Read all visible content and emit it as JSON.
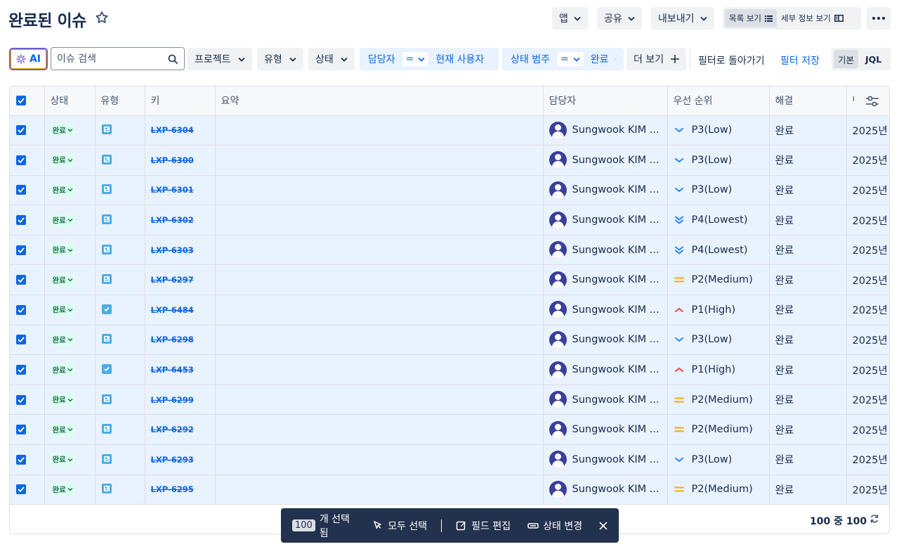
{
  "header": {
    "title": "완료된 이슈",
    "apps_label": "앱",
    "share_label": "공유",
    "export_label": "내보내기",
    "list_view_label": "목록 보기",
    "detail_view_label": "세부 정보 보기"
  },
  "filters": {
    "ai_label": "AI",
    "search_placeholder": "이슈 검색",
    "project_label": "프로젝트",
    "type_label": "유형",
    "status_label": "상태",
    "assignee_label": "담당자",
    "assignee_op": "=",
    "assignee_value": "현재 사용자",
    "status_category_label": "상태 범주",
    "status_category_op": "=",
    "status_category_value": "완료",
    "more_label": "더 보기",
    "back_to_filter_label": "필터로 돌아가기",
    "save_filter_label": "필터 저장",
    "basic_label": "기본",
    "jql_label": "JQL"
  },
  "table": {
    "columns": [
      "상태",
      "유형",
      "키",
      "요약",
      "담당자",
      "우선 순위",
      "해결",
      "만"
    ],
    "rows": [
      {
        "status": "완료",
        "type": "image",
        "key": "LXP-6304",
        "summary": "",
        "assignee": "Sungwook KIM ...",
        "priority": "P3(Low)",
        "priority_level": "low",
        "resolution": "완료",
        "date": "2025년"
      },
      {
        "status": "완료",
        "type": "image",
        "key": "LXP-6300",
        "summary": "",
        "assignee": "Sungwook KIM ...",
        "priority": "P3(Low)",
        "priority_level": "low",
        "resolution": "완료",
        "date": "2025년"
      },
      {
        "status": "완료",
        "type": "image",
        "key": "LXP-6301",
        "summary": "",
        "assignee": "Sungwook KIM ...",
        "priority": "P3(Low)",
        "priority_level": "low",
        "resolution": "완료",
        "date": "2025년"
      },
      {
        "status": "완료",
        "type": "image",
        "key": "LXP-6302",
        "summary": "",
        "assignee": "Sungwook KIM ...",
        "priority": "P4(Lowest)",
        "priority_level": "lowest",
        "resolution": "완료",
        "date": "2025년"
      },
      {
        "status": "완료",
        "type": "image",
        "key": "LXP-6303",
        "summary": "",
        "assignee": "Sungwook KIM ...",
        "priority": "P4(Lowest)",
        "priority_level": "lowest",
        "resolution": "완료",
        "date": "2025년"
      },
      {
        "status": "완료",
        "type": "image",
        "key": "LXP-6297",
        "summary": "",
        "assignee": "Sungwook KIM ...",
        "priority": "P2(Medium)",
        "priority_level": "medium",
        "resolution": "완료",
        "date": "2025년"
      },
      {
        "status": "완료",
        "type": "task",
        "key": "LXP-6484",
        "summary": "",
        "assignee": "Sungwook KIM ...",
        "priority": "P1(High)",
        "priority_level": "high",
        "resolution": "완료",
        "date": "2025년"
      },
      {
        "status": "완료",
        "type": "image",
        "key": "LXP-6298",
        "summary": "",
        "assignee": "Sungwook KIM ...",
        "priority": "P3(Low)",
        "priority_level": "low",
        "resolution": "완료",
        "date": "2025년"
      },
      {
        "status": "완료",
        "type": "task",
        "key": "LXP-6453",
        "summary": "",
        "assignee": "Sungwook KIM ...",
        "priority": "P1(High)",
        "priority_level": "high",
        "resolution": "완료",
        "date": "2025년"
      },
      {
        "status": "완료",
        "type": "image",
        "key": "LXP-6299",
        "summary": "",
        "assignee": "Sungwook KIM ...",
        "priority": "P2(Medium)",
        "priority_level": "medium",
        "resolution": "완료",
        "date": "2025년"
      },
      {
        "status": "완료",
        "type": "image",
        "key": "LXP-6292",
        "summary": "",
        "assignee": "Sungwook KIM ...",
        "priority": "P2(Medium)",
        "priority_level": "medium",
        "resolution": "완료",
        "date": "2025년"
      },
      {
        "status": "완료",
        "type": "image",
        "key": "LXP-6293",
        "summary": "",
        "assignee": "Sungwook KIM ...",
        "priority": "P3(Low)",
        "priority_level": "low",
        "resolution": "완료",
        "date": "2025년"
      },
      {
        "status": "완료",
        "type": "image",
        "key": "LXP-6295",
        "summary": "",
        "assignee": "Sungwook KIM ...",
        "priority": "P2(Medium)",
        "priority_level": "medium",
        "resolution": "완료",
        "date": "2025년"
      }
    ]
  },
  "footer": {
    "count_text": "100 중 100"
  },
  "selection_bar": {
    "count": "100",
    "selected_label": "개 선택됨",
    "select_all_label": "모두 선택",
    "edit_fields_label": "필드 편집",
    "change_status_label": "상태 변경"
  },
  "colors": {
    "accent": "#0c66e4",
    "selected_row": "#e9f2ff",
    "done_lozenge": "#dcfff1",
    "priority_low": "#2684ff",
    "priority_medium": "#ffab00",
    "priority_high": "#e34935",
    "selection_bar": "#22314d"
  }
}
